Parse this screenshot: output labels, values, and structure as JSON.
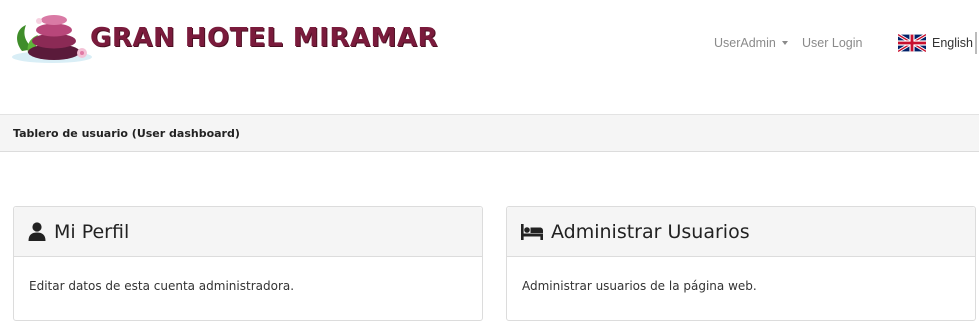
{
  "header": {
    "brand_name": "GRAN HOTEL MIRAMAR",
    "logo_icon": "spa-stones-logo",
    "colors": {
      "brand": "#7a1b3c",
      "nav_link": "#8a8a8a"
    }
  },
  "nav": {
    "user_admin_label": "UserAdmin",
    "user_login_label": "User Login",
    "language_label": "English",
    "language_flag_icon": "uk-flag-icon"
  },
  "breadcrumb": {
    "title": "Tablero de usuario (User dashboard)"
  },
  "panels": [
    {
      "title": "Mi Perfil",
      "icon": "user-icon",
      "description": "Editar datos de esta cuenta administradora."
    },
    {
      "title": "Administrar Usuarios",
      "icon": "bed-icon",
      "description": "Administrar usuarios de la página web."
    }
  ]
}
